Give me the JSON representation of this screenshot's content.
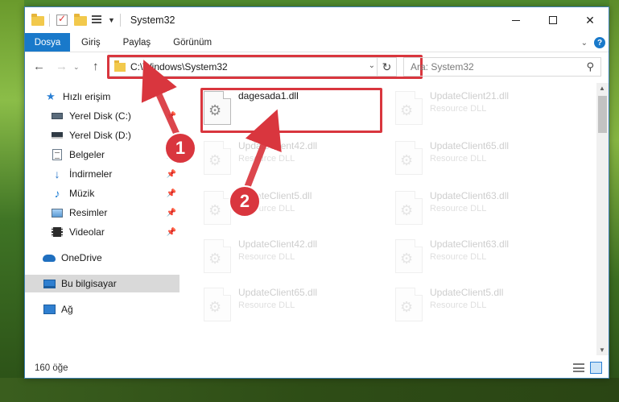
{
  "window": {
    "title": "System32",
    "minimize_glyph": "",
    "maximize_glyph": "",
    "close_glyph": "✕"
  },
  "ribbon": {
    "tabs": [
      {
        "label": "Dosya",
        "active": true
      },
      {
        "label": "Giriş"
      },
      {
        "label": "Paylaş"
      },
      {
        "label": "Görünüm"
      }
    ],
    "help_label": "?"
  },
  "navigation": {
    "address_path": "C:\\Windows\\System32",
    "search_placeholder": "Ara: System32",
    "back_icon": "arrow-left",
    "forward_icon": "arrow-right",
    "up_icon": "arrow-up",
    "refresh_icon": "refresh"
  },
  "sidebar": {
    "quick_access": "Hızlı erişim",
    "items": [
      {
        "label": "Yerel Disk (C:)",
        "icon": "drive-icon",
        "pinned": true
      },
      {
        "label": "Yerel Disk (D:)",
        "icon": "drive-icon",
        "pinned": false
      },
      {
        "label": "Belgeler",
        "icon": "documents-icon",
        "pinned": true
      },
      {
        "label": "İndirmeler",
        "icon": "downloads-icon",
        "pinned": true
      },
      {
        "label": "Müzik",
        "icon": "music-icon",
        "pinned": true
      },
      {
        "label": "Resimler",
        "icon": "pictures-icon",
        "pinned": true
      },
      {
        "label": "Videolar",
        "icon": "videos-icon",
        "pinned": true
      }
    ],
    "onedrive": "OneDrive",
    "this_pc": "Bu bilgisayar",
    "network": "Ağ",
    "selected": "Bu bilgisayar"
  },
  "files": [
    {
      "name": "dagesada1.dll",
      "type": "",
      "highlighted": true
    },
    {
      "name": "UpdateClient21.dll",
      "type": "Resource DLL"
    },
    {
      "name": "UpdateClient42.dll",
      "type": "Resource DLL"
    },
    {
      "name": "UpdateClient65.dll",
      "type": "Resource DLL"
    },
    {
      "name": "UpdateClient5.dll",
      "type": "Resource DLL"
    },
    {
      "name": "UpdateClient63.dll",
      "type": "Resource DLL"
    },
    {
      "name": "UpdateClient42.dll",
      "type": "Resource DLL"
    },
    {
      "name": "UpdateClient63.dll",
      "type": "Resource DLL"
    },
    {
      "name": "UpdateClient65.dll",
      "type": "Resource DLL"
    },
    {
      "name": "UpdateClient5.dll",
      "type": "Resource DLL"
    }
  ],
  "status": {
    "item_count": "160 öğe"
  },
  "callouts": {
    "step1": "1",
    "step2": "2",
    "color": "#d9363e"
  },
  "colors": {
    "accent": "#1979ca",
    "highlight": "#d9363e"
  }
}
